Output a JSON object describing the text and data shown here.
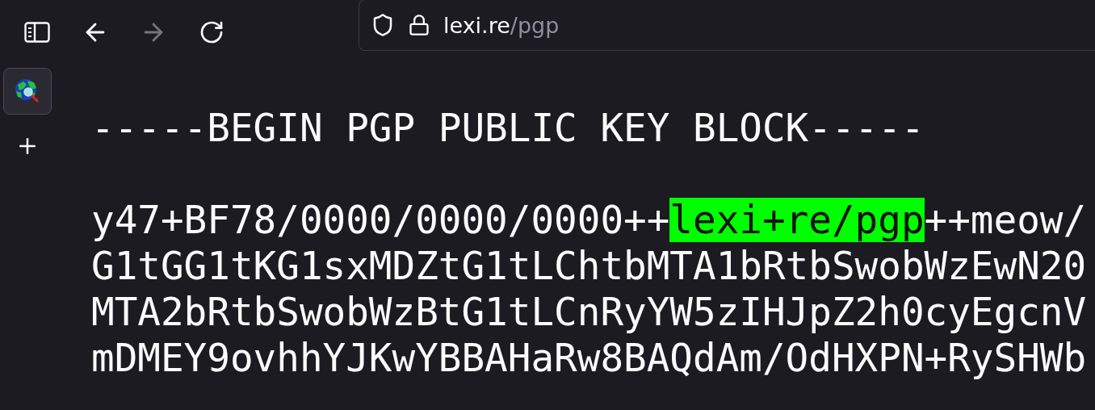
{
  "toolbar": {
    "buttons": [
      {
        "kind": "sidebar",
        "disabled": false
      },
      {
        "kind": "back",
        "disabled": false
      },
      {
        "kind": "forward",
        "disabled": true
      },
      {
        "kind": "reload",
        "disabled": false
      }
    ]
  },
  "address_bar": {
    "host": "lexi.re",
    "path": "/pgp"
  },
  "vertical_tabs": [
    {
      "selected": true
    }
  ],
  "content": {
    "header": "-----BEGIN PGP PUBLIC KEY BLOCK-----",
    "lines": [
      [
        {
          "text": "y47+BF78/0000/0000/0000++",
          "highlighted": false
        },
        {
          "text": "lexi+re/pgp",
          "highlighted": true
        },
        {
          "text": "++meow/",
          "highlighted": false
        }
      ],
      [
        {
          "text": "G1tGG1tKG1sxMDZtG1tLChtbMTA1bRtbSwobWzEwN20",
          "highlighted": false
        }
      ],
      [
        {
          "text": "MTA2bRtbSwobWzBtG1tLCnRyYW5zIHJpZ2h0cyEgcnV",
          "highlighted": false
        }
      ],
      [
        {
          "text": "mDMEY9ovhhYJKwYBBAHaRw8BAQdAm/OdHXPN+RySHWb",
          "highlighted": false
        }
      ]
    ]
  }
}
